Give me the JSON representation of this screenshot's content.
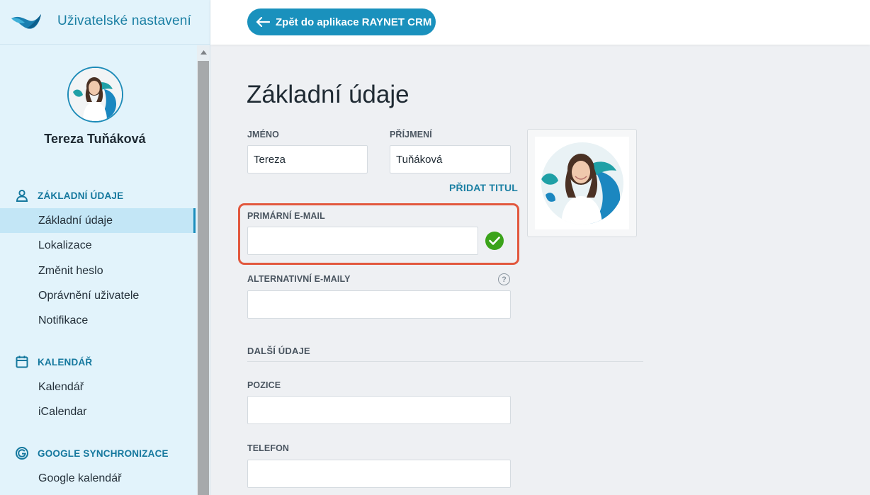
{
  "app": {
    "title": "Uživatelské nastavení",
    "back_button": "Zpět do aplikace RAYNET CRM"
  },
  "user": {
    "name": "Tereza Tuňáková"
  },
  "sidebar": {
    "sections": [
      {
        "title": "ZÁKLADNÍ ÚDAJE",
        "icon": "person-icon",
        "items": [
          "Základní údaje",
          "Lokalizace",
          "Změnit heslo",
          "Oprávnění uživatele",
          "Notifikace"
        ]
      },
      {
        "title": "KALENDÁŘ",
        "icon": "calendar-icon",
        "items": [
          "Kalendář",
          "iCalendar"
        ]
      },
      {
        "title": "GOOGLE SYNCHRONIZACE",
        "icon": "google-icon",
        "items": [
          "Google kalendář"
        ]
      }
    ],
    "active_item": "Základní údaje"
  },
  "main": {
    "title": "Základní údaje",
    "first_name": {
      "label": "JMÉNO",
      "value": "Tereza"
    },
    "last_name": {
      "label": "PŘÍJMENÍ",
      "value": "Tuňáková"
    },
    "add_title_link": "PŘIDAT TITUL",
    "primary_email": {
      "label": "PRIMÁRNÍ E-MAIL",
      "value": ""
    },
    "alt_emails": {
      "label": "ALTERNATIVNÍ E-MAILY",
      "value": "",
      "help": "?"
    },
    "more_section": "DALŠÍ ÚDAJE",
    "position": {
      "label": "POZICE",
      "value": ""
    },
    "phone": {
      "label": "TELEFON",
      "value": ""
    }
  },
  "colors": {
    "accent": "#1a91bd",
    "sidebar_bg": "#e2f3fb",
    "highlight": "#e2583e",
    "verified": "#3ba31a"
  }
}
